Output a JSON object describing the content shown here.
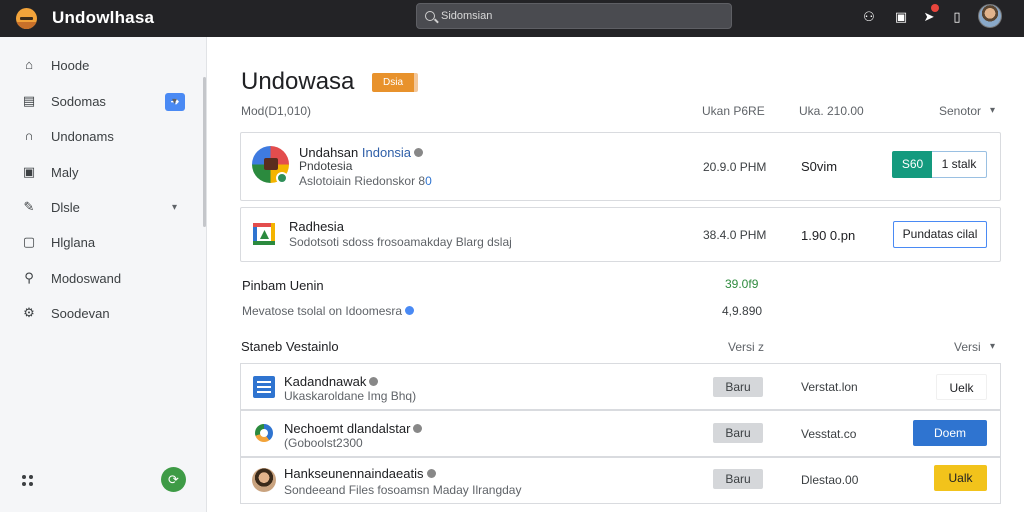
{
  "app": {
    "title": "Undowlhasa"
  },
  "search": {
    "placeholder": "Sidomsian"
  },
  "sidebar": {
    "items": [
      {
        "label": "Hoode",
        "icon": "home-icon"
      },
      {
        "label": "Sodomas",
        "icon": "inbox-icon"
      },
      {
        "label": "Undonams",
        "icon": "arch-icon"
      },
      {
        "label": "Maly",
        "icon": "layout-icon"
      },
      {
        "label": "Dlsle",
        "icon": "pencil-icon"
      },
      {
        "label": "Hlglana",
        "icon": "doc-icon"
      },
      {
        "label": "Modoswand",
        "icon": "user-icon"
      },
      {
        "label": "Soodevan",
        "icon": "gear-icon"
      }
    ]
  },
  "main": {
    "title": "Undowasa",
    "title_badge": "Dsia",
    "list_header": {
      "left": "Mod(D1,010)",
      "col1": "Ukan P6RE",
      "col2": "Uka. 210.00",
      "sort": "Senotor"
    },
    "cards": [
      {
        "title": "Undahsan ",
        "title_accent": "Indonsia",
        "subtitle": "Pndotesia",
        "meta": "Aslotoiain Riedonskor 8",
        "meta_num": "0",
        "time": "20.9.0 PHM",
        "amount": "S0vim",
        "btn_primary": "S60",
        "btn_secondary": "1 stalk"
      },
      {
        "title": "Radhesia",
        "meta": "Sodotsoti sdoss frosoamakday Blarg dslaj",
        "time": "38.4.0 PHM",
        "amount": "1.90 0.pn",
        "btn_secondary": "Pundatas cilal"
      }
    ],
    "summary": {
      "title": "Pinbam Uenin",
      "value": "39.0f9",
      "subtitle": "Mevatose tsolal on Idoomesra",
      "sub_value": "4,9.890"
    },
    "section": {
      "title": "Staneb Vestainlo",
      "col": "Versi z",
      "filter": "Versi"
    },
    "rows": [
      {
        "title": "Kadandnawak",
        "meta": "Ukaskaroldane Img Bhq)",
        "pill": "Baru",
        "status": "Verstat.lon",
        "action": "Uelk",
        "style": "plain"
      },
      {
        "title": "Nechoemt dlandalstar",
        "meta": "(Goboolst2300",
        "pill": "Baru",
        "status": "Vesstat.co",
        "action": "Doem",
        "style": "blue"
      },
      {
        "title": "Hankseunennaindaeatis",
        "meta": "Sondeeand Files fosoamsn Maday Ilrangday",
        "pill": "Baru",
        "status": "Dlestao.00",
        "action": "Ualk",
        "style": "yellow"
      }
    ]
  },
  "colors": {
    "topbar": "#232326",
    "accent_blue": "#4a8af4",
    "accent_green": "#149a7e",
    "badge_orange": "#e8922c",
    "yellow": "#f2c31b"
  }
}
